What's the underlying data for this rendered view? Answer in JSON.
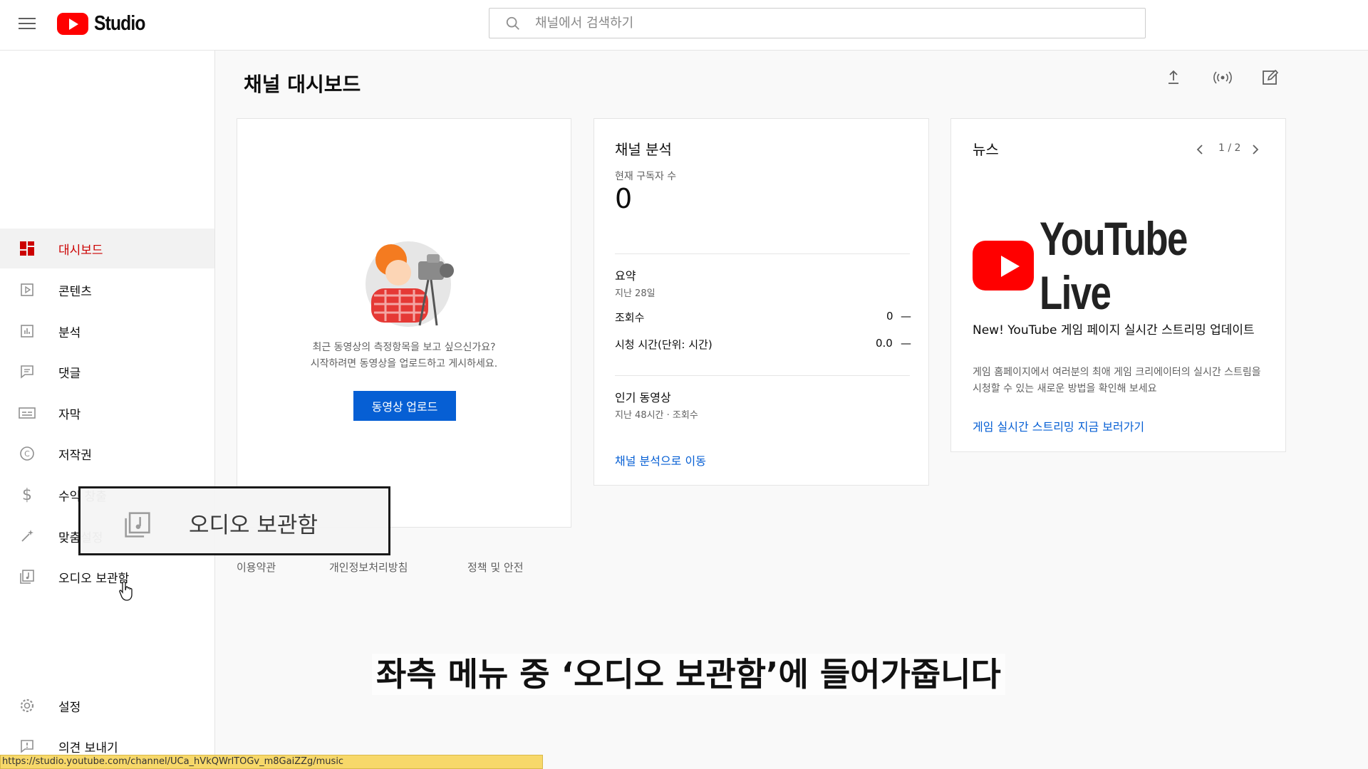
{
  "app": {
    "logo_text": "Studio"
  },
  "search": {
    "placeholder": "채널에서 검색하기"
  },
  "sidebar": {
    "items": [
      {
        "label": "대시보드",
        "icon": "dashboard-icon",
        "active": true
      },
      {
        "label": "콘텐츠",
        "icon": "content-icon"
      },
      {
        "label": "분석",
        "icon": "analytics-icon"
      },
      {
        "label": "댓글",
        "icon": "comments-icon"
      },
      {
        "label": "자막",
        "icon": "subtitles-icon"
      },
      {
        "label": "저작권",
        "icon": "copyright-icon"
      },
      {
        "label": "수익 창출",
        "icon": "dollar-icon"
      },
      {
        "label": "맞춤설정",
        "icon": "magic-wand-icon"
      },
      {
        "label": "오디오 보관함",
        "icon": "audio-library-icon"
      }
    ],
    "settings_label": "설정",
    "feedback_label": "의견 보내기"
  },
  "main": {
    "title": "채널 대시보드"
  },
  "upload_card": {
    "message_line1": "최근 동영상의 측정항목을 보고 싶으신가요?",
    "message_line2": "시작하려면 동영상을 업로드하고 게시하세요.",
    "button_label": "동영상 업로드"
  },
  "analytics_card": {
    "title": "채널 분석",
    "subscribers_label": "현재 구독자 수",
    "subscribers_value": "0",
    "summary_title": "요약",
    "summary_period": "지난 28일",
    "views_label": "조회수",
    "views_value": "0",
    "views_trend": "—",
    "watch_label": "시청 시간(단위: 시간)",
    "watch_value": "0.0",
    "watch_trend": "—",
    "top_videos_title": "인기 동영상",
    "top_videos_period": "지난 48시간 · 조회수",
    "link": "채널 분석으로 이동"
  },
  "news_card": {
    "title": "뉴스",
    "pager": "1 / 2",
    "banner_text": "YouTube Live",
    "headline": "New! YouTube 게임 페이지 실시간 스트리밍 업데이트",
    "body": "게임 홈페이지에서 여러분의 최애 게임 크리에이터의 실시간 스트림을 시청할 수 있는 새로운 방법을 확인해 보세요",
    "link": "게임 실시간 스트리밍 지금 보러가기"
  },
  "footer": {
    "terms": "이용약관",
    "privacy": "개인정보처리방침",
    "policy": "정책 및 안전"
  },
  "popup": {
    "label": "오디오 보관함"
  },
  "caption": "좌측 메뉴 중 ‘오디오 보관함’에 들어가줍니다",
  "status_url": "https://studio.youtube.com/channel/UCa_hVkQWrlTOGv_m8GaiZZg/music",
  "colors": {
    "accent_red": "#ff0000",
    "active_red": "#cc0000",
    "link_blue": "#065fd4"
  }
}
